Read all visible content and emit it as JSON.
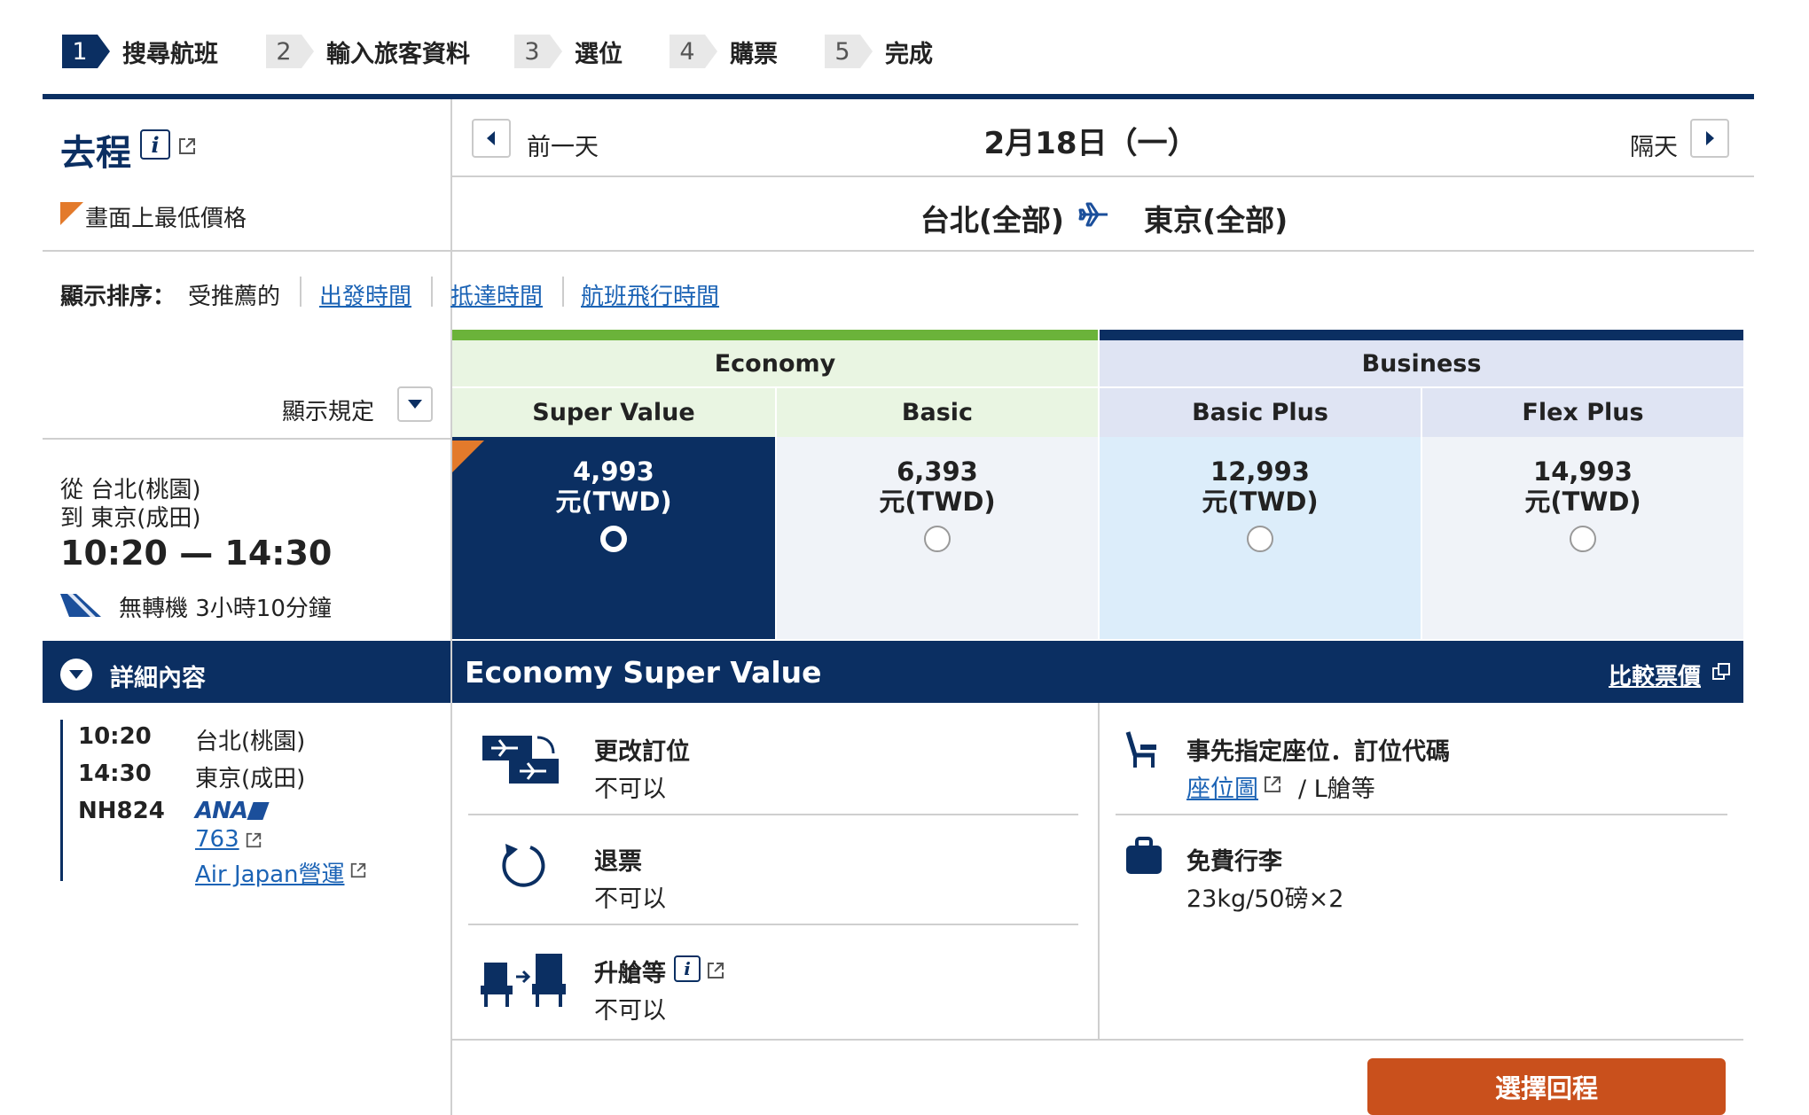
{
  "steps": [
    {
      "num": "1",
      "label": "搜尋航班",
      "active": true
    },
    {
      "num": "2",
      "label": "輸入旅客資料",
      "active": false
    },
    {
      "num": "3",
      "label": "選位",
      "active": false
    },
    {
      "num": "4",
      "label": "購票",
      "active": false
    },
    {
      "num": "5",
      "label": "完成",
      "active": false
    }
  ],
  "outbound": {
    "title": "去程",
    "lowest_price_note": "畫面上最低價格"
  },
  "date_nav": {
    "prev": "前一天",
    "date": "2月18日（一）",
    "next": "隔天"
  },
  "route": {
    "from": "台北(全部)",
    "to": "東京(全部)"
  },
  "sort": {
    "label": "顯示排序：",
    "current": "受推薦的",
    "options": [
      "出發時間",
      "抵達時間",
      "航班飛行時間"
    ]
  },
  "display_rules": "顯示規定",
  "cabins": [
    {
      "name": "Economy",
      "color": "#6bb33a"
    },
    {
      "name": "Business",
      "color": "#0b2f62"
    }
  ],
  "fares": [
    {
      "name": "Super Value",
      "price": "4,993",
      "currency": "元(TWD)",
      "selected": true
    },
    {
      "name": "Basic",
      "price": "6,393",
      "currency": "元(TWD)",
      "selected": false
    },
    {
      "name": "Basic Plus",
      "price": "12,993",
      "currency": "元(TWD)",
      "selected": false
    },
    {
      "name": "Flex Plus",
      "price": "14,993",
      "currency": "元(TWD)",
      "selected": false
    }
  ],
  "flight": {
    "from": "從 台北(桃園)",
    "to": "到 東京(成田)",
    "time": "10:20 — 14:30",
    "stops": "無轉機 3小時10分鐘"
  },
  "details": {
    "toggle_label": "詳細內容",
    "dep_time": "10:20",
    "dep_airport": "台北(桃園)",
    "arr_time": "14:30",
    "arr_airport": "東京(成田)",
    "flight_no": "NH824",
    "airline_logo": "ANA",
    "aircraft": "763",
    "operator": "Air Japan營運"
  },
  "fare_detail": {
    "title": "Economy Super Value",
    "compare": "比較票價",
    "change_title": "更改訂位",
    "change_val": "不可以",
    "refund_title": "退票",
    "refund_val": "不可以",
    "upgrade_title": "升艙等",
    "upgrade_val": "不可以",
    "seat_title": "事先指定座位．訂位代碼",
    "seat_map": "座位圖",
    "seat_class": "/ L艙等",
    "baggage_title": "免費行李",
    "baggage_val": "23kg/50磅×2"
  },
  "select_return": "選擇回程"
}
